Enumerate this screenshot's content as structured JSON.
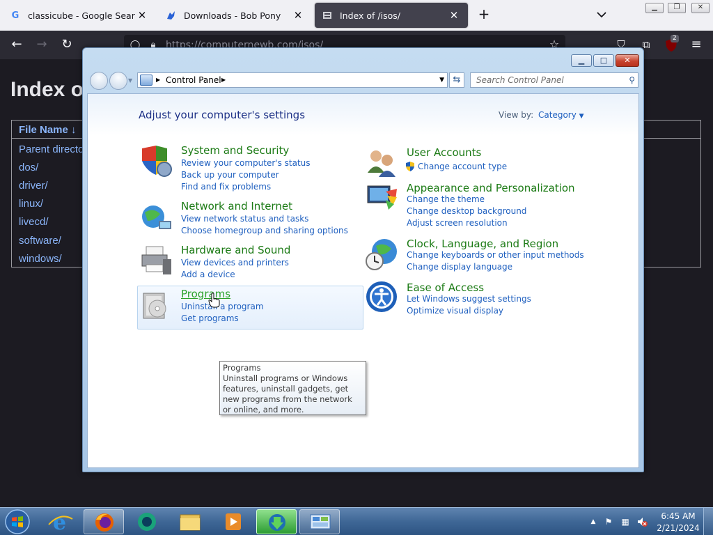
{
  "browser": {
    "tabs": [
      {
        "title": "classicube - Google Search",
        "favicon": "google-icon"
      },
      {
        "title": "Downloads - Bob Pony",
        "favicon": "bob-pony-icon"
      },
      {
        "title": "Index of /isos/",
        "favicon": "server-icon",
        "active": true
      }
    ],
    "url": "https://computernewb.com/isos/",
    "extension_badge": "2"
  },
  "webpage": {
    "heading": "Index o",
    "column_header": "File Name  ↓",
    "rows": [
      "Parent directo",
      "dos/",
      "driver/",
      "linux/",
      "livecd/",
      "software/",
      "windows/"
    ]
  },
  "control_panel": {
    "breadcrumb": "Control Panel",
    "search_placeholder": "Search Control Panel",
    "heading": "Adjust your computer's settings",
    "view_by_label": "View by:",
    "view_by_value": "Category",
    "categories": [
      {
        "title": "System and Security",
        "icon": "shield-icon",
        "links": [
          "Review your computer's status",
          "Back up your computer",
          "Find and fix problems"
        ]
      },
      {
        "title": "Network and Internet",
        "icon": "globe-network-icon",
        "links": [
          "View network status and tasks",
          "Choose homegroup and sharing options"
        ]
      },
      {
        "title": "Hardware and Sound",
        "icon": "printer-icon",
        "links": [
          "View devices and printers",
          "Add a device"
        ]
      },
      {
        "title": "Programs",
        "icon": "programs-box-icon",
        "links": [
          "Uninstall a program",
          "Get programs"
        ]
      },
      {
        "title": "User Accounts",
        "icon": "users-icon",
        "links": [
          "Change account type"
        ]
      },
      {
        "title": "Appearance and Personalization",
        "icon": "monitor-paint-icon",
        "links": [
          "Change the theme",
          "Change desktop background",
          "Adjust screen resolution"
        ]
      },
      {
        "title": "Clock, Language, and Region",
        "icon": "clock-globe-icon",
        "links": [
          "Change keyboards or other input methods",
          "Change display language"
        ]
      },
      {
        "title": "Ease of Access",
        "icon": "ease-of-access-icon",
        "links": [
          "Let Windows suggest settings",
          "Optimize visual display"
        ]
      }
    ],
    "tooltip": {
      "title": "Programs",
      "body": "Uninstall programs or Windows features, uninstall gadgets, get new programs from the network or online, and more."
    }
  },
  "taskbar": {
    "time": "6:45 AM",
    "date": "2/21/2024",
    "pinned": [
      "internet-explorer-icon",
      "firefox-icon",
      "browser-icon",
      "file-explorer-icon",
      "media-player-icon",
      "download-manager-icon",
      "control-panel-icon"
    ]
  },
  "colors": {
    "category_title": "#1b7a14",
    "link": "#1e5fbf",
    "heading": "#1e3287"
  }
}
